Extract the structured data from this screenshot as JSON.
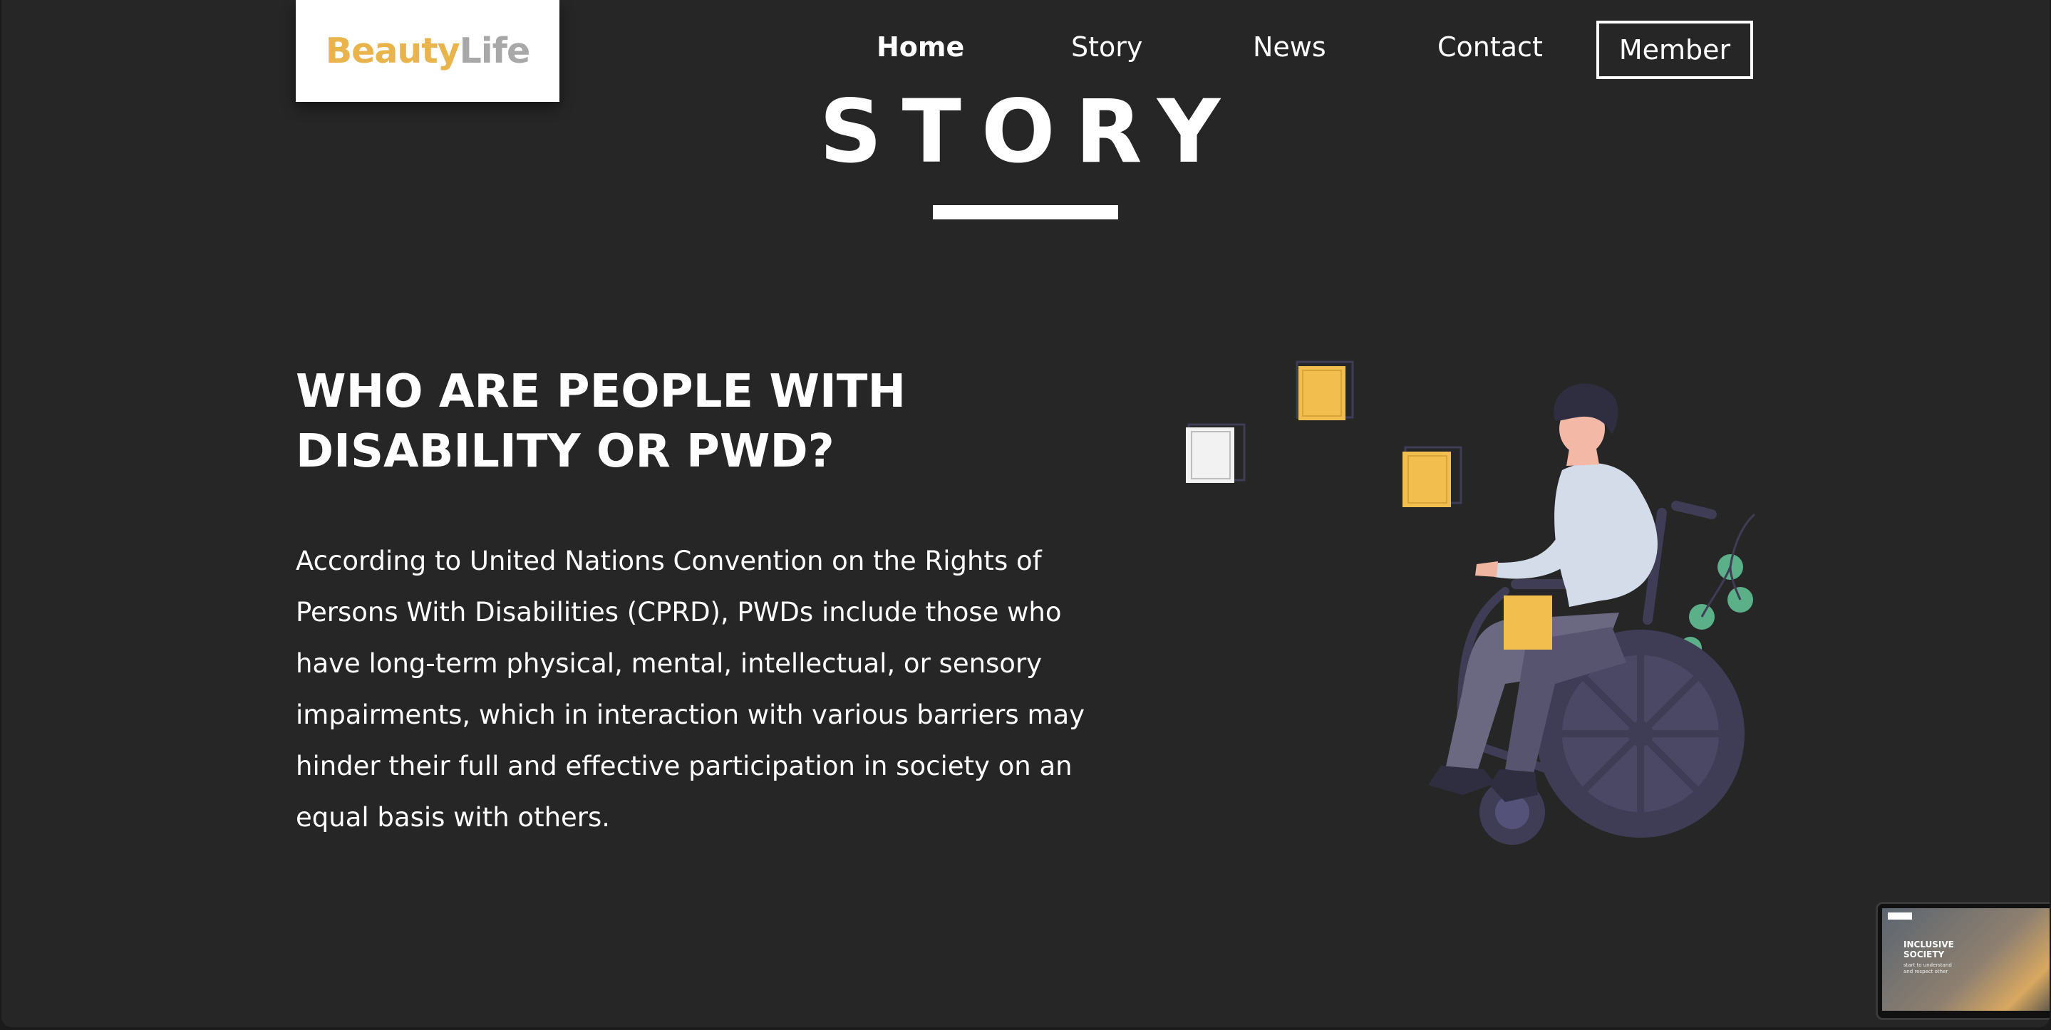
{
  "brand": {
    "part1": "Beauty",
    "part2": "Life",
    "color_primary": "#e9b44c",
    "color_secondary": "#a8a8a8"
  },
  "nav": {
    "items": [
      {
        "label": "Home",
        "active": true
      },
      {
        "label": "Story",
        "active": false
      },
      {
        "label": "News",
        "active": false
      },
      {
        "label": "Contact",
        "active": false
      }
    ],
    "member_label": "Member"
  },
  "page": {
    "title": "STORY"
  },
  "section": {
    "heading": "WHO ARE PEOPLE WITH DISABILITY OR PWD?",
    "body": "According to United Nations Convention on the Rights of Persons With Disabilities (CPRD), PWDs include those who have long-term physical, mental, intellectual, or sensory impairments, which in interaction with various barriers may hinder their full and effective participation in society on an equal basis with others."
  },
  "thumbnail": {
    "title": "INCLUSIVE SOCIETY",
    "subtitle": "start to understand and respect other"
  },
  "colors": {
    "background": "#262626",
    "accent": "#f2be4e",
    "text": "#ffffff"
  }
}
